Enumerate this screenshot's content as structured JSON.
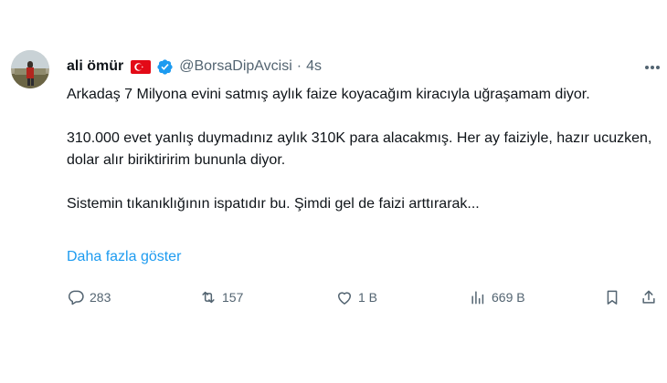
{
  "author": {
    "name": "ali ömür",
    "handle": "@BorsaDipAvcisi",
    "separator": "·",
    "time": "4s"
  },
  "tweet": {
    "paragraphs": [
      "Arkadaş 7 Milyona evini satmış aylık faize koyacağım kiracıyla uğraşamam diyor.",
      "310.000 evet yanlış duymadınız aylık 310K para alacakmış. Her ay faiziyle, hazır ucuzken, dolar alır biriktiririm bununla diyor.",
      "Sistemin tıkanıklığının ispatıdır bu. Şimdi gel de faizi arttırarak..."
    ],
    "show_more": "Daha fazla göster"
  },
  "actions": {
    "replies": "283",
    "retweets": "157",
    "likes": "1 B",
    "views": "669 B"
  },
  "colors": {
    "text": "#0f1419",
    "secondary": "#536471",
    "link": "#1d9bf0",
    "verified": "#1d9bf0",
    "flag_red": "#e30a17"
  },
  "icons": [
    "turkey-flag-icon",
    "verified-badge-icon",
    "more-options-icon",
    "reply-icon",
    "retweet-icon",
    "like-icon",
    "views-icon",
    "bookmark-icon",
    "share-icon"
  ]
}
